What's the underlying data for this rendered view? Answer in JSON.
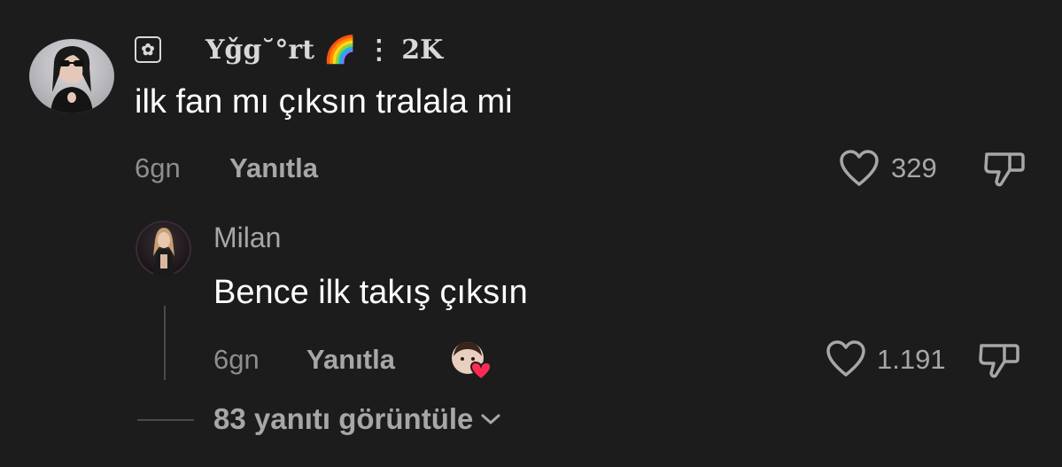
{
  "comment": {
    "username": "Yǧg˘°rt",
    "username_suffix": "🌈 ⋮ 2K",
    "text": "ilk fan mı çıksın tralala mi",
    "time": "6gn",
    "reply_label": "Yanıtla",
    "likes": "329",
    "avatar_icon": "user-avatar-sunglasses",
    "badge_icon": "flower-badge-icon"
  },
  "reply": {
    "username": "Milan",
    "text": "Bence ilk takış çıksın",
    "time": "6gn",
    "reply_label": "Yanıtla",
    "likes": "1.191",
    "avatar_icon": "user-avatar-stage",
    "creator_liked_icon": "creator-liked-heart-icon"
  },
  "view_replies": {
    "label": "83 yanıtı görüntüle",
    "icon": "chevron-down-icon"
  },
  "colors": {
    "background": "#1c1c1c",
    "text_primary": "#ffffff",
    "text_secondary": "#a7a7a7",
    "heart_red": "#fe2c55"
  }
}
